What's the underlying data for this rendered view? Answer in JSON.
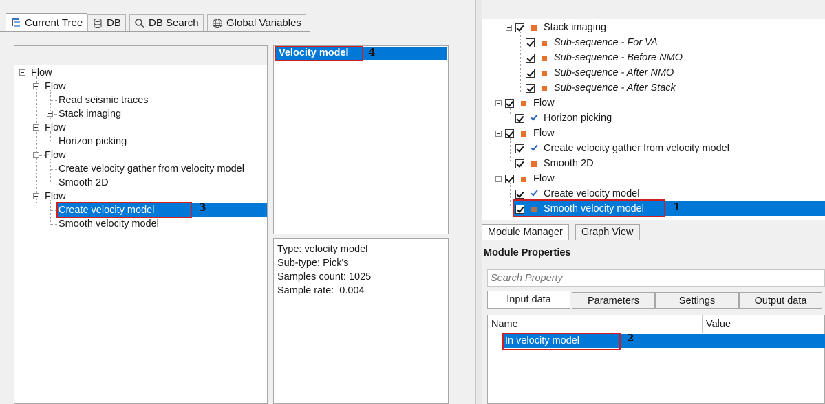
{
  "left_tabs": [
    {
      "label": "Current Tree",
      "icon": "tree-icon",
      "active": true
    },
    {
      "label": "DB",
      "icon": "database-icon",
      "active": false
    },
    {
      "label": "DB Search",
      "icon": "search-icon",
      "active": false
    },
    {
      "label": "Global Variables",
      "icon": "globe-icon",
      "active": false
    }
  ],
  "current_tree": {
    "items": [
      {
        "label": "Flow"
      },
      {
        "label": "Flow"
      },
      {
        "label": "Read seismic traces"
      },
      {
        "label": "Stack imaging"
      },
      {
        "label": "Flow"
      },
      {
        "label": "Horizon picking"
      },
      {
        "label": "Flow"
      },
      {
        "label": "Create velocity gather from velocity model"
      },
      {
        "label": "Smooth 2D"
      },
      {
        "label": "Flow"
      },
      {
        "label": "Create velocity model",
        "selected": true
      },
      {
        "label": "Smooth velocity model"
      }
    ]
  },
  "output_list": {
    "items": [
      {
        "label": "Velocity model",
        "selected": true
      }
    ]
  },
  "info": {
    "type": "Type: velocity model",
    "subtype": "Sub-type: Pick's",
    "samples_count": "Samples count: 1025",
    "sample_rate": "Sample rate:  0.004"
  },
  "flow_tree": {
    "items": [
      {
        "label": "Stack imaging",
        "italic": false
      },
      {
        "label": "Sub-sequence - For VA",
        "italic": true
      },
      {
        "label": "Sub-sequence - Before NMO",
        "italic": true
      },
      {
        "label": "Sub-sequence - After NMO",
        "italic": true
      },
      {
        "label": "Sub-sequence - After Stack",
        "italic": true
      },
      {
        "label": "Flow",
        "italic": false
      },
      {
        "label": "Horizon picking",
        "italic": false
      },
      {
        "label": "Flow",
        "italic": false
      },
      {
        "label": "Create velocity gather from velocity model",
        "italic": false
      },
      {
        "label": "Smooth 2D",
        "italic": false
      },
      {
        "label": "Flow",
        "italic": false
      },
      {
        "label": "Create velocity model",
        "italic": false
      },
      {
        "label": "Smooth velocity model",
        "italic": false,
        "selected": true
      }
    ]
  },
  "view_tabs": [
    {
      "label": "Module Manager",
      "active": true
    },
    {
      "label": "Graph View",
      "active": false
    }
  ],
  "module_properties": {
    "title": "Module Properties",
    "search_placeholder": "Search Property",
    "tabs": [
      {
        "label": "Input data",
        "active": true
      },
      {
        "label": "Parameters",
        "active": false
      },
      {
        "label": "Settings",
        "active": false
      },
      {
        "label": "Output data",
        "active": false
      }
    ],
    "columns": [
      "Name",
      "Value"
    ],
    "rows": [
      {
        "name": "In velocity model",
        "value": "",
        "selected": true
      }
    ]
  },
  "callouts": {
    "one": "1",
    "two": "2",
    "three": "3",
    "four": "4"
  },
  "colors": {
    "selection": "#0078d7",
    "highlight_box": "#d11e1e",
    "module_marker": "#e8702a",
    "check_blue": "#1f5fbf"
  }
}
